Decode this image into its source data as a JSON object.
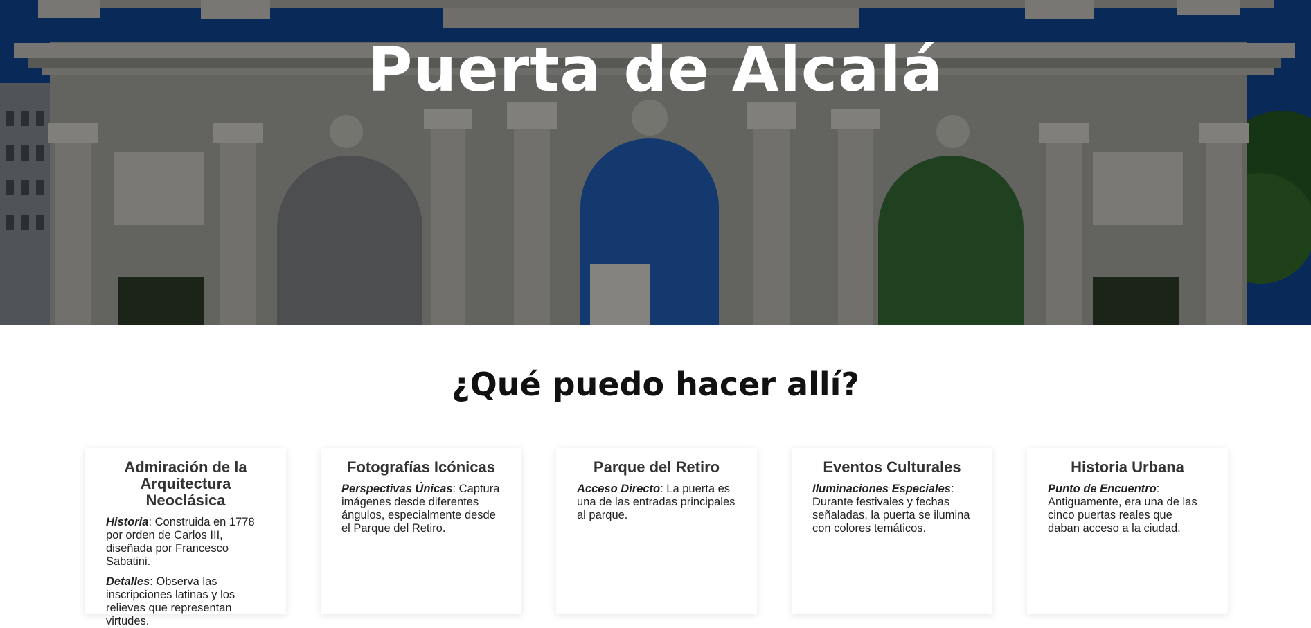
{
  "hero": {
    "title": "Puerta de Alcalá"
  },
  "section": {
    "title": "¿Qué puedo hacer allí?"
  },
  "cards": [
    {
      "title": "Admiración de la Arquitectura Neoclásica",
      "items": [
        {
          "label": "Historia",
          "text": ": Construida en 1778 por orden de Carlos III, diseñada por Francesco Sabatini."
        },
        {
          "label": "Detalles",
          "text": ": Observa las inscripciones latinas y los relieves que representan virtudes."
        }
      ]
    },
    {
      "title": "Fotografías Icónicas",
      "items": [
        {
          "label": "Perspectivas Únicas",
          "text": ": Captura imágenes desde diferentes ángulos, especialmente desde el Parque del Retiro."
        }
      ]
    },
    {
      "title": "Parque del Retiro",
      "items": [
        {
          "label": "Acceso Directo",
          "text": ": La puerta es una de las entradas principales al parque."
        }
      ]
    },
    {
      "title": "Eventos Culturales",
      "items": [
        {
          "label": "Iluminaciones Especiales",
          "text": ": Durante festivales y fechas señaladas, la puerta se ilumina con colores temáticos."
        }
      ]
    },
    {
      "title": "Historia Urbana",
      "items": [
        {
          "label": "Punto de Encuentro",
          "text": ": Antiguamente, era una de las cinco puertas reales que daban acceso a la ciudad."
        }
      ]
    }
  ]
}
